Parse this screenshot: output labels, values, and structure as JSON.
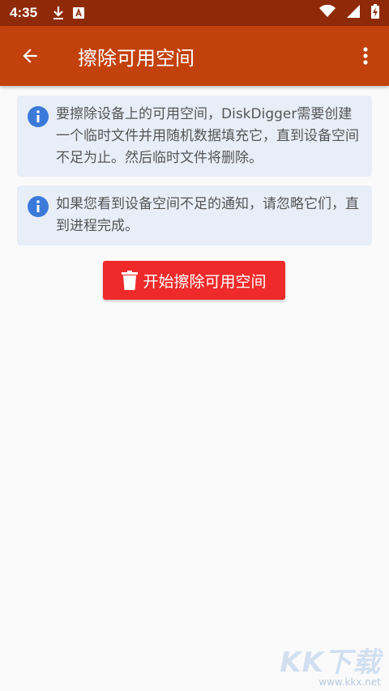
{
  "status_bar": {
    "time": "4:35",
    "icons_left": [
      "download-icon",
      "font-icon"
    ],
    "icons_right": [
      "wifi-icon",
      "signal-icon",
      "battery-charging-icon"
    ]
  },
  "app_bar": {
    "title": "擦除可用空间",
    "back_icon": "arrow-back-icon",
    "menu_icon": "more-vert-icon",
    "color": "#c2410c"
  },
  "info_cards": [
    {
      "icon": "info-icon",
      "text": "要擦除设备上的可用空间，DiskDigger需要创建一个临时文件并用随机数据填充它，直到设备空间不足为止。然后临时文件将删除。"
    },
    {
      "icon": "info-icon",
      "text": "如果您看到设备空间不足的通知，请忽略它们，直到进程完成。"
    }
  ],
  "erase_button": {
    "label": "开始擦除可用空间",
    "icon": "trash-icon",
    "color": "#ef2a2a"
  },
  "watermark": {
    "logo": "KK下载",
    "url": "www.kkx.net"
  }
}
